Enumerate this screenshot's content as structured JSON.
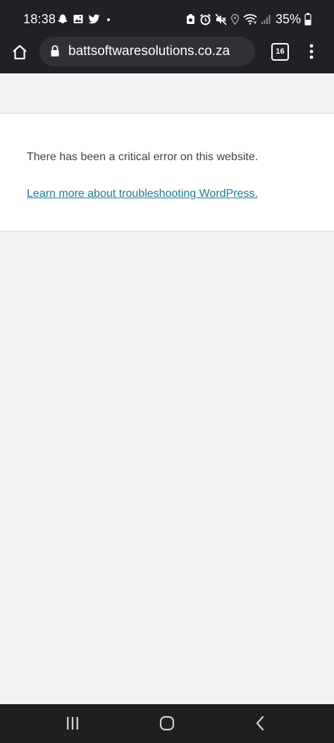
{
  "status_bar": {
    "time": "18:38",
    "battery_percent": "35%",
    "left_icons": [
      "snapchat-icon",
      "gallery-icon",
      "twitter-icon",
      "dot-icon"
    ],
    "right_icons": [
      "alarm-clock-icon",
      "alarm-icon",
      "mute-icon",
      "location-icon",
      "wifi-icon",
      "signal-icon",
      "battery-icon"
    ]
  },
  "browser": {
    "url": "battsoftwaresolutions.co.za",
    "tab_count": "16"
  },
  "page": {
    "error_message": "There has been a critical error on this website.",
    "help_link_text": "Learn more about troubleshooting WordPress."
  },
  "colors": {
    "chrome_bar": "#202124",
    "url_box": "#303134",
    "page_background": "#f1f1f1",
    "card_background": "#ffffff",
    "text": "#3c434a",
    "link": "#1c7a92",
    "nav_bar": "#1f1f1f"
  }
}
